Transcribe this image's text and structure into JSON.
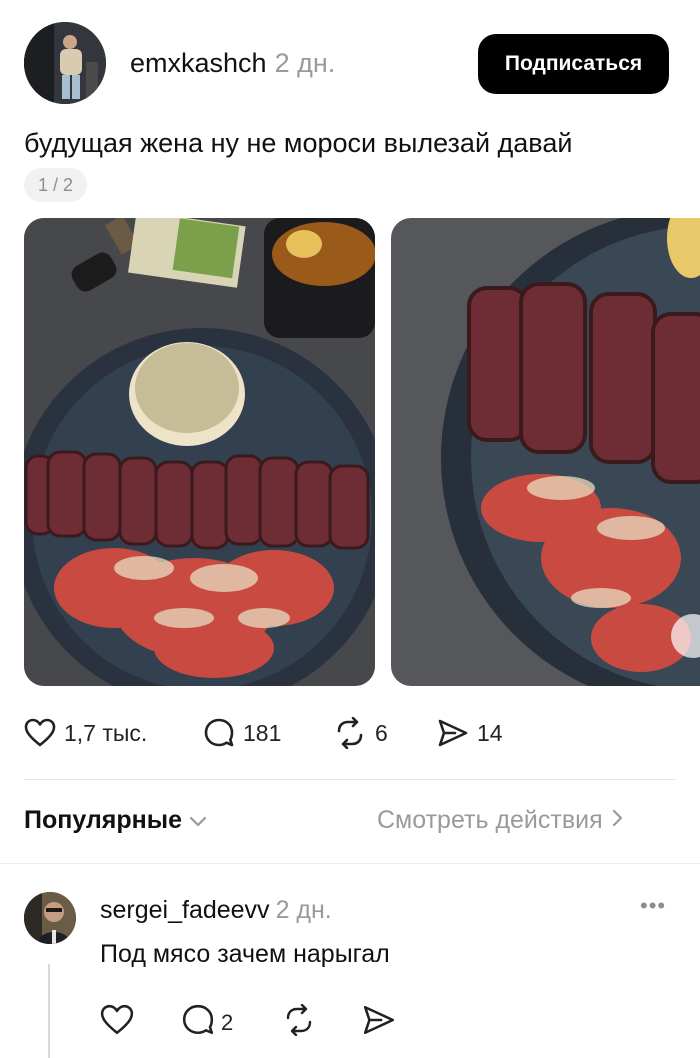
{
  "post": {
    "author": "emxkashch",
    "time_ago": "2 дн.",
    "follow_label": "Подписаться",
    "caption": "будущая жена ну не мороси вылезай давай",
    "image_counter": "1 / 2",
    "stats": {
      "likes": "1,7 тыс.",
      "replies": "181",
      "reposts": "6",
      "shares": "14"
    }
  },
  "sort": {
    "label": "Популярные",
    "activity_link": "Смотреть действия"
  },
  "comment": {
    "author": "sergei_fadeevv",
    "time_ago": "2 дн.",
    "more": "•••",
    "text": "Под мясо зачем нарыгал",
    "replies": "2"
  },
  "icons": {
    "like": "heart-icon",
    "reply": "speech-bubble-icon",
    "repost": "repost-icon",
    "share": "send-icon",
    "sort": "chevron-down-icon",
    "link": "chevron-right-icon",
    "more": "more-dots-icon"
  }
}
